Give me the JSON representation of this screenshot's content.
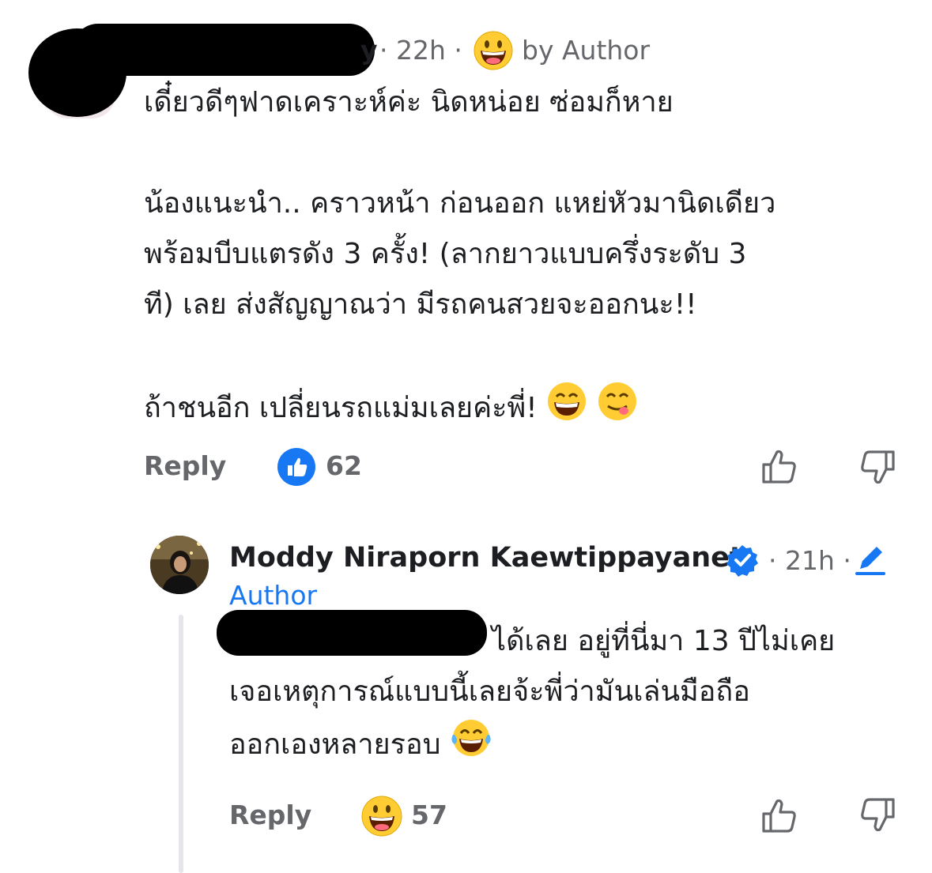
{
  "comment1": {
    "name_suffix": "y",
    "meta_time": "· 22h ·",
    "author_badge": "by Author",
    "paragraphs": [
      "เดี๋ยวดีๆฟาดเคราะห์ค่ะ นิดหน่อย ซ่อมก็หาย",
      "น้องแนะนำ.. คราวหน้า ก่อนออก แหย่หัวมานิดเดียว",
      "พร้อมบีบแตรดัง 3 ครั้ง! (ลากยาวแบบครึ่งระดับ 3",
      "ที) เลย ส่งสัญญาณว่า มีรถคนสวยจะออกนะ!!",
      "ถ้าชนอีก เปลี่ยนรถแม่มเลยค่ะพี่!"
    ],
    "reply_label": "Reply",
    "reaction_count": "62",
    "reaction_icon": "like-icon"
  },
  "comment2": {
    "author_name": "Moddy Niraporn Kaewtippayanet",
    "time": "· 21h ·",
    "author_label": "Author",
    "lines": [
      "ได้เลย อยู่ที่นี่มา 13 ปีไม่เคย",
      "เจอเหตุการณ์แบบนี้เลยจ้ะพี่ว่ามันเล่นมือถือ",
      "ออกเองหลายรอบ"
    ],
    "reply_label": "Reply",
    "reaction_count": "57",
    "reaction_icon": "haha-icon"
  },
  "colors": {
    "accent": "#1877f2",
    "meta": "#65676b",
    "text": "#1c1e21"
  }
}
